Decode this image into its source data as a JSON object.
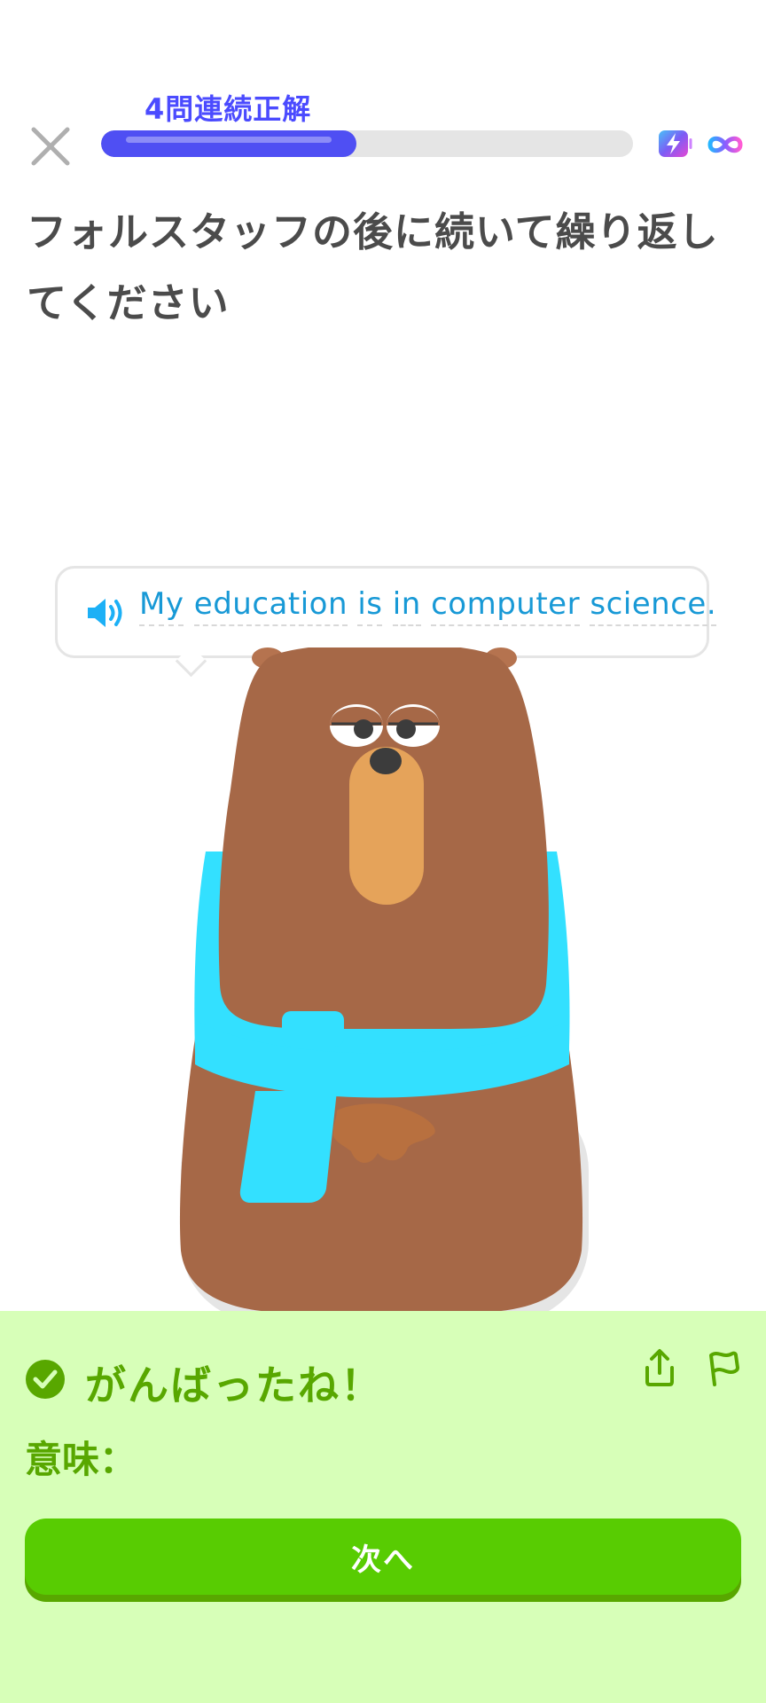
{
  "header": {
    "streak_label": "4問連続正解",
    "progress_fraction": 0.48
  },
  "prompt": {
    "instruction": "フォルスタッフの後に続いて繰り返してください"
  },
  "speech_bubble": {
    "words": [
      "My",
      "education",
      "is",
      "in",
      "computer",
      "science."
    ]
  },
  "feedback": {
    "title": "がんばったね！",
    "meaning_label": "意味：",
    "next_label": "次へ"
  },
  "colors": {
    "accent": "#4f4ff3",
    "success": "#58cc02",
    "success_dark": "#58a700",
    "feedback_bg": "#d7ffb8",
    "bubble_text": "#1899d6",
    "bear_fur": "#a66847",
    "scarf": "#33e0ff"
  },
  "icons": [
    "close-icon",
    "energy-icon",
    "infinity-icon",
    "speaker-icon",
    "check-circle-icon",
    "share-icon",
    "flag-icon"
  ]
}
